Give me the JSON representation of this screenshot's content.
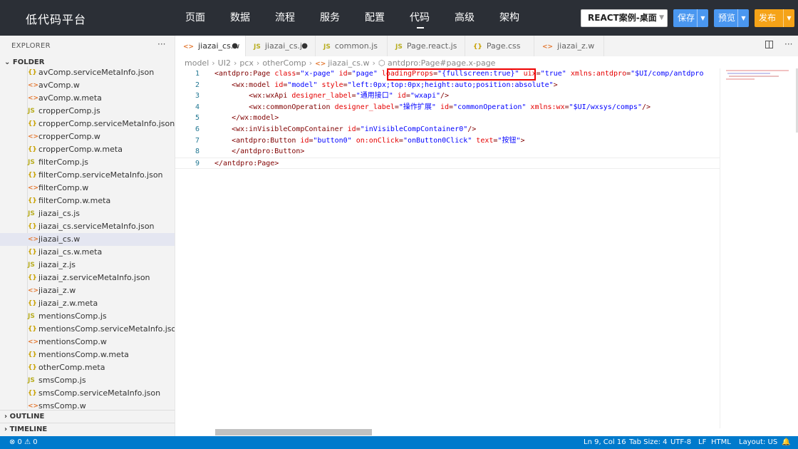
{
  "app": {
    "title": "低代码平台"
  },
  "nav": {
    "items": [
      "页面",
      "数据",
      "流程",
      "服务",
      "配置",
      "代码",
      "高级",
      "架构"
    ],
    "active": "代码"
  },
  "toolbar": {
    "combo": "REACT案例-桌面",
    "save": "保存",
    "preview": "预览",
    "publish": "发布"
  },
  "explorer": {
    "title": "EXPLORER",
    "more": "···",
    "folder": "FOLDER",
    "files": [
      {
        "name": "avComp.serviceMetaInfo.json",
        "icon": "{}",
        "type": "json"
      },
      {
        "name": "avComp.w",
        "icon": "<>",
        "type": "w"
      },
      {
        "name": "avComp.w.meta",
        "icon": "<>",
        "type": "w"
      },
      {
        "name": "cropperComp.js",
        "icon": "JS",
        "type": "js"
      },
      {
        "name": "cropperComp.serviceMetaInfo.json",
        "icon": "{}",
        "type": "json"
      },
      {
        "name": "cropperComp.w",
        "icon": "<>",
        "type": "w"
      },
      {
        "name": "cropperComp.w.meta",
        "icon": "{}",
        "type": "json"
      },
      {
        "name": "filterComp.js",
        "icon": "JS",
        "type": "js"
      },
      {
        "name": "filterComp.serviceMetaInfo.json",
        "icon": "{}",
        "type": "json"
      },
      {
        "name": "filterComp.w",
        "icon": "<>",
        "type": "w"
      },
      {
        "name": "filterComp.w.meta",
        "icon": "{}",
        "type": "json"
      },
      {
        "name": "jiazai_cs.js",
        "icon": "JS",
        "type": "js"
      },
      {
        "name": "jiazai_cs.serviceMetaInfo.json",
        "icon": "{}",
        "type": "json"
      },
      {
        "name": "jiazai_cs.w",
        "icon": "<>",
        "type": "w"
      },
      {
        "name": "jiazai_cs.w.meta",
        "icon": "{}",
        "type": "json"
      },
      {
        "name": "jiazai_z.js",
        "icon": "JS",
        "type": "js"
      },
      {
        "name": "jiazai_z.serviceMetaInfo.json",
        "icon": "{}",
        "type": "json"
      },
      {
        "name": "jiazai_z.w",
        "icon": "<>",
        "type": "w"
      },
      {
        "name": "jiazai_z.w.meta",
        "icon": "{}",
        "type": "json"
      },
      {
        "name": "mentionsComp.js",
        "icon": "JS",
        "type": "js"
      },
      {
        "name": "mentionsComp.serviceMetaInfo.json",
        "icon": "{}",
        "type": "json"
      },
      {
        "name": "mentionsComp.w",
        "icon": "<>",
        "type": "w"
      },
      {
        "name": "mentionsComp.w.meta",
        "icon": "{}",
        "type": "json"
      },
      {
        "name": "otherComp.meta",
        "icon": "{}",
        "type": "json"
      },
      {
        "name": "smsComp.js",
        "icon": "JS",
        "type": "js"
      },
      {
        "name": "smsComp.serviceMetaInfo.json",
        "icon": "{}",
        "type": "json"
      },
      {
        "name": "smsComp.w",
        "icon": "<>",
        "type": "w"
      }
    ],
    "active_file": "jiazai_cs.w",
    "outline": "OUTLINE",
    "timeline": "TIMELINE"
  },
  "tabs": [
    {
      "label": "jiazai_cs.w",
      "icon": "<>",
      "type": "w",
      "dirty": true
    },
    {
      "label": "jiazai_cs.js",
      "icon": "JS",
      "type": "js",
      "dirty": true
    },
    {
      "label": "common.js",
      "icon": "JS",
      "type": "js",
      "dirty": false
    },
    {
      "label": "Page.react.js",
      "icon": "JS",
      "type": "js",
      "dirty": false
    },
    {
      "label": "Page.css",
      "icon": "{}",
      "type": "json",
      "dirty": false
    },
    {
      "label": "jiazai_z.w",
      "icon": "<>",
      "type": "w",
      "dirty": false
    }
  ],
  "breadcrumb": {
    "parts": [
      "model",
      "UI2",
      "pcx",
      "otherComp",
      "jiazai_cs.w",
      "antdpro:Page#page.x-page"
    ]
  },
  "code": {
    "lines": [
      [
        [
          "t-p",
          "<"
        ],
        [
          "t-tag",
          "antdpro:Page "
        ],
        [
          "t-attr",
          "class"
        ],
        [
          "t-p",
          "="
        ],
        [
          "t-val",
          "\"x-page\""
        ],
        [
          "t-attr",
          " id"
        ],
        [
          "t-p",
          "="
        ],
        [
          "t-val",
          "\"page\""
        ],
        [
          "t-p",
          " "
        ],
        [
          "t-attr",
          "loadingProps"
        ],
        [
          "t-p",
          "="
        ],
        [
          "t-val",
          "\"{fullscreen:true}\""
        ],
        [
          "t-p",
          " "
        ],
        [
          "t-attr",
          "uix"
        ],
        [
          "t-p",
          "="
        ],
        [
          "t-val",
          "\"true\""
        ],
        [
          "t-attr",
          " xmlns:antdpro"
        ],
        [
          "t-p",
          "="
        ],
        [
          "t-val",
          "\"$UI/comp/antdpro"
        ]
      ],
      [
        [
          "t-p",
          "    <"
        ],
        [
          "t-tag",
          "wx:model "
        ],
        [
          "t-attr",
          "id"
        ],
        [
          "t-p",
          "="
        ],
        [
          "t-val",
          "\"model\""
        ],
        [
          "t-attr",
          " style"
        ],
        [
          "t-p",
          "="
        ],
        [
          "t-val",
          "\"left:0px;top:0px;height:auto;position:absolute\""
        ],
        [
          "t-p",
          ">"
        ]
      ],
      [
        [
          "t-p",
          "        <"
        ],
        [
          "t-tag",
          "wx:wxApi "
        ],
        [
          "t-attr",
          "designer_label"
        ],
        [
          "t-p",
          "="
        ],
        [
          "t-val",
          "\"通用接口\""
        ],
        [
          "t-attr",
          " id"
        ],
        [
          "t-p",
          "="
        ],
        [
          "t-val",
          "\"wxapi\""
        ],
        [
          "t-p",
          "/>"
        ]
      ],
      [
        [
          "t-p",
          "        <"
        ],
        [
          "t-tag",
          "wx:commonOperation "
        ],
        [
          "t-attr",
          "designer_label"
        ],
        [
          "t-p",
          "="
        ],
        [
          "t-val",
          "\"操作扩展\""
        ],
        [
          "t-attr",
          " id"
        ],
        [
          "t-p",
          "="
        ],
        [
          "t-val",
          "\"commonOperation\""
        ],
        [
          "t-attr",
          " xmlns:wx"
        ],
        [
          "t-p",
          "="
        ],
        [
          "t-val",
          "\"$UI/wxsys/comps\""
        ],
        [
          "t-p",
          "/>"
        ]
      ],
      [
        [
          "t-p",
          "    </"
        ],
        [
          "t-tag",
          "wx:model"
        ],
        [
          "t-p",
          ">"
        ]
      ],
      [
        [
          "t-p",
          "    <"
        ],
        [
          "t-tag",
          "wx:inVisibleCompContainer "
        ],
        [
          "t-attr",
          "id"
        ],
        [
          "t-p",
          "="
        ],
        [
          "t-val",
          "\"inVisibleCompContainer0\""
        ],
        [
          "t-p",
          "/>"
        ]
      ],
      [
        [
          "t-p",
          "    <"
        ],
        [
          "t-tag",
          "antdpro:Button "
        ],
        [
          "t-attr",
          "id"
        ],
        [
          "t-p",
          "="
        ],
        [
          "t-val",
          "\"button0\""
        ],
        [
          "t-attr",
          " on:onClick"
        ],
        [
          "t-p",
          "="
        ],
        [
          "t-val",
          "\"onButton0Click\""
        ],
        [
          "t-attr",
          " text"
        ],
        [
          "t-p",
          "="
        ],
        [
          "t-val",
          "\"按钮\""
        ],
        [
          "t-p",
          ">"
        ]
      ],
      [
        [
          "t-p",
          "    </"
        ],
        [
          "t-tag",
          "antdpro:Button"
        ],
        [
          "t-p",
          ">"
        ]
      ],
      [
        [
          "t-p",
          "</"
        ],
        [
          "t-tag",
          "antdpro:Page"
        ],
        [
          "t-p",
          ">"
        ]
      ]
    ]
  },
  "statusbar": {
    "problems": "⊗ 0 ⚠ 0",
    "position": "Ln 9, Col 16",
    "tabsize": "Tab Size: 4",
    "encoding": "UTF-8",
    "eol": "LF",
    "language": "HTML",
    "layout": "Layout: US"
  }
}
